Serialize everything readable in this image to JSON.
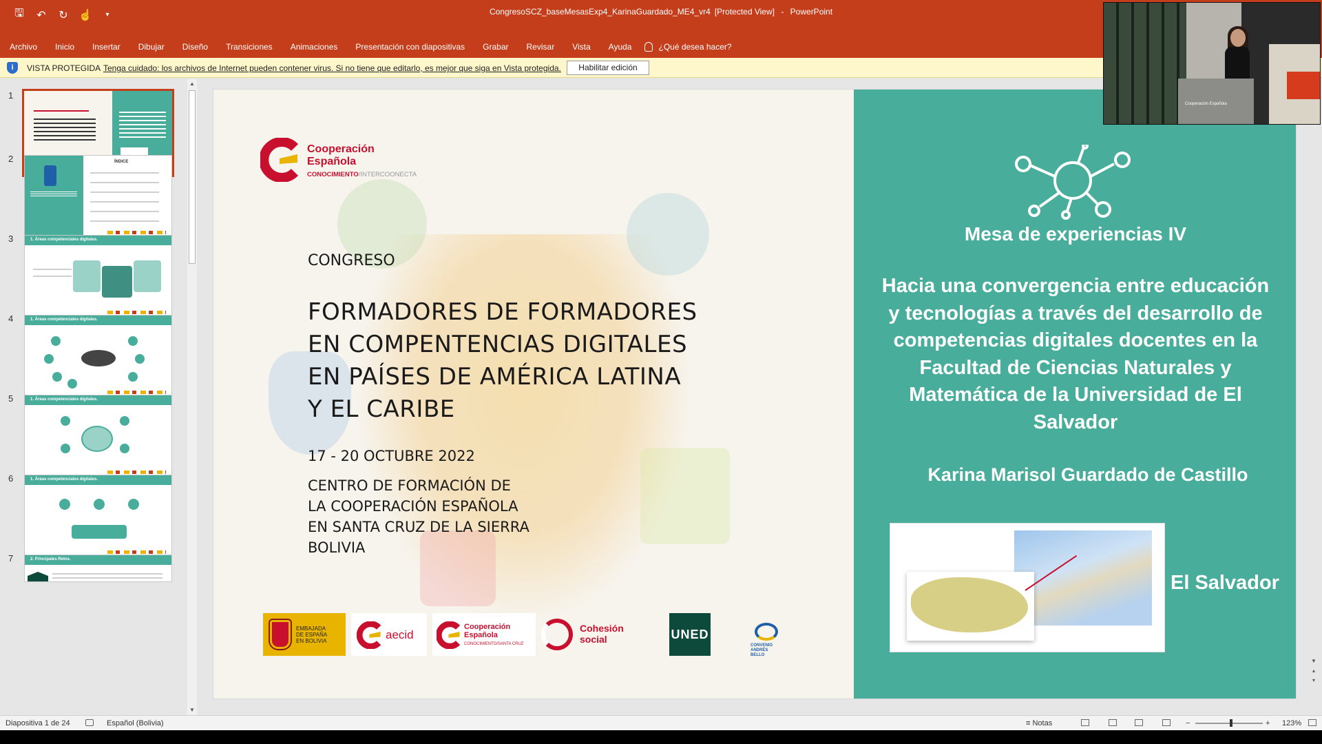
{
  "window": {
    "title": "CongresoSCZ_baseMesasExp4_KarinaGuardado_ME4_vr4",
    "mode": "[Protected View]",
    "separator": "-",
    "app": "PowerPoint"
  },
  "qat": {
    "save_icon": "save-icon",
    "undo_icon": "undo-icon",
    "redo_icon": "redo-icon",
    "touch_icon": "touch-mode-icon",
    "customize_icon": "customize-qat-icon"
  },
  "ribbon": {
    "tabs": [
      "Archivo",
      "Inicio",
      "Insertar",
      "Dibujar",
      "Diseño",
      "Transiciones",
      "Animaciones",
      "Presentación con diapositivas",
      "Grabar",
      "Revisar",
      "Vista",
      "Ayuda"
    ],
    "tell_me": "¿Qué desea hacer?"
  },
  "protected_bar": {
    "label": "VISTA PROTEGIDA",
    "message": "Tenga cuidado: los archivos de Internet pueden contener virus. Si no tiene que editarlo, es mejor que siga en Vista protegida.",
    "enable_button": "Habilitar edición"
  },
  "thumbnails": {
    "numbers": [
      "1",
      "2",
      "3",
      "4",
      "5",
      "6",
      "7"
    ],
    "selected": "1",
    "slide2_title": "ÍNDICE",
    "slide3_title": "1.  Áreas competenciales digitales.",
    "slide4_title": "1.  Áreas competenciales digitales.",
    "slide5_title": "1.  Áreas competenciales digitales.",
    "slide6_title": "1.  Áreas competenciales digitales.",
    "slide7_title": "2.  Principales Retos."
  },
  "slide": {
    "logo": {
      "line1": "Cooperación",
      "line2": "Española",
      "line3a": "CONOCIMIENTO",
      "line3b": "/INTERCOONECTA"
    },
    "congreso_label": "CONGRESO",
    "title_lines": [
      "FORMADORES DE FORMADORES",
      "EN COMPENTENCIAS DIGITALES",
      "EN PAÍSES DE AMÉRICA LATINA",
      "Y EL CARIBE"
    ],
    "dates": "17 - 20 OCTUBRE 2022",
    "venue_lines": [
      "CENTRO DE FORMACIÓN DE",
      "LA COOPERACIÓN ESPAÑOLA",
      "EN SANTA CRUZ DE LA SIERRA",
      "BOLIVIA"
    ],
    "sponsors": {
      "embajada": [
        "EMBAJADA",
        "DE ESPAÑA",
        "EN BOLIVIA"
      ],
      "aecid": "aecid",
      "coop": [
        "Cooperación",
        "Española",
        "CONOCIMIENTO/SANTA CRUZ"
      ],
      "cohesion": [
        "Cohesión",
        "social"
      ],
      "uned": "UNED",
      "andres": [
        "CONVENIO",
        "ANDRÉS",
        "BELLO"
      ]
    },
    "session_title": "Mesa de experiencias IV",
    "talk_title": "Hacia una convergencia entre educación y tecnologías a través del desarrollo de competencias digitales docentes en la Facultad de Ciencias Naturales y Matemática de la Universidad de El Salvador",
    "speaker": "Karina Marisol Guardado de Castillo",
    "country": "El Salvador",
    "colors": {
      "teal": "#48ad9b",
      "accent": "#c43e1c",
      "brand_red": "#c8102e"
    }
  },
  "webcam": {
    "podium_label": "Cooperación Española"
  },
  "status": {
    "slide_info": "Diapositiva 1 de 24",
    "language": "Español (Bolivia)",
    "notes": "Notas",
    "zoom": "123%",
    "zoom_fraction": 0.53
  }
}
